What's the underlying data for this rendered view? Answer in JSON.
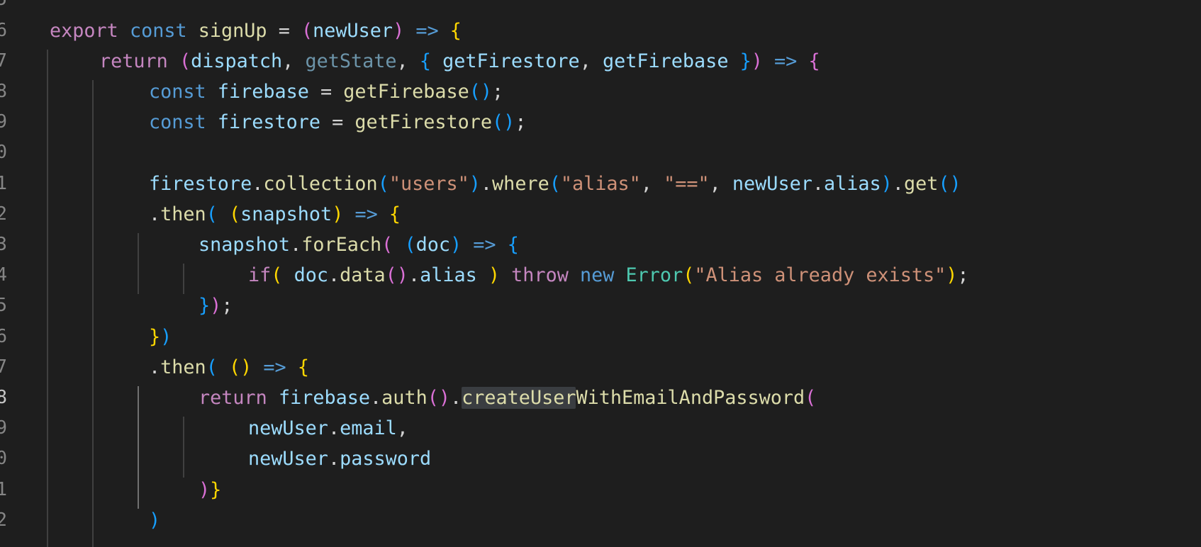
{
  "line_numbers": [
    "5",
    "6",
    "7",
    "8",
    "9",
    "0",
    "1",
    "2",
    "3",
    "4",
    "5",
    "6",
    "7",
    "8",
    "9",
    "0",
    "1",
    "2"
  ],
  "active_line_number": "8",
  "colors": {
    "background": "#1e1e1e",
    "keyword_control": "#c586c0",
    "keyword_storage": "#569cd6",
    "function": "#dcdcaa",
    "variable": "#9cdcfe",
    "string": "#ce9178",
    "class": "#4ec9b0",
    "bracket_1": "#ffd700",
    "bracket_2": "#da70d6",
    "bracket_3": "#179fff",
    "selection_highlight": "#3a3d41"
  },
  "code_lines": [
    [],
    [
      [
        "k-ctrl",
        "export"
      ],
      [
        "punc",
        " "
      ],
      [
        "k-st",
        "const"
      ],
      [
        "punc",
        " "
      ],
      [
        "fn",
        "signUp"
      ],
      [
        "punc",
        " = "
      ],
      [
        "b2",
        "("
      ],
      [
        "var",
        "newUser"
      ],
      [
        "b2",
        ")"
      ],
      [
        "punc",
        " "
      ],
      [
        "k-st",
        "=>"
      ],
      [
        "punc",
        " "
      ],
      [
        "b1",
        "{"
      ]
    ],
    [
      [
        "k-ctrl",
        "return"
      ],
      [
        "punc",
        " "
      ],
      [
        "b2",
        "("
      ],
      [
        "var",
        "dispatch"
      ],
      [
        "punc",
        ", "
      ],
      [
        "dim",
        "getState"
      ],
      [
        "punc",
        ", "
      ],
      [
        "b3",
        "{"
      ],
      [
        "punc",
        " "
      ],
      [
        "var",
        "getFirestore"
      ],
      [
        "punc",
        ", "
      ],
      [
        "var",
        "getFirebase"
      ],
      [
        "punc",
        " "
      ],
      [
        "b3",
        "}"
      ],
      [
        "b2",
        ")"
      ],
      [
        "punc",
        " "
      ],
      [
        "k-st",
        "=>"
      ],
      [
        "punc",
        " "
      ],
      [
        "b2",
        "{"
      ]
    ],
    [
      [
        "k-st",
        "const"
      ],
      [
        "punc",
        " "
      ],
      [
        "var",
        "firebase"
      ],
      [
        "punc",
        " = "
      ],
      [
        "fn",
        "getFirebase"
      ],
      [
        "b3",
        "()"
      ],
      [
        "punc",
        ";"
      ]
    ],
    [
      [
        "k-st",
        "const"
      ],
      [
        "punc",
        " "
      ],
      [
        "var",
        "firestore"
      ],
      [
        "punc",
        " = "
      ],
      [
        "fn",
        "getFirestore"
      ],
      [
        "b3",
        "()"
      ],
      [
        "punc",
        ";"
      ]
    ],
    [],
    [
      [
        "var",
        "firestore"
      ],
      [
        "punc",
        "."
      ],
      [
        "fn",
        "collection"
      ],
      [
        "b3",
        "("
      ],
      [
        "str",
        "\"users\""
      ],
      [
        "b3",
        ")"
      ],
      [
        "punc",
        "."
      ],
      [
        "fn",
        "where"
      ],
      [
        "b3",
        "("
      ],
      [
        "str",
        "\"alias\""
      ],
      [
        "punc",
        ", "
      ],
      [
        "str",
        "\"==\""
      ],
      [
        "punc",
        ", "
      ],
      [
        "var",
        "newUser"
      ],
      [
        "punc",
        "."
      ],
      [
        "var",
        "alias"
      ],
      [
        "b3",
        ")"
      ],
      [
        "punc",
        "."
      ],
      [
        "fn",
        "get"
      ],
      [
        "b3",
        "()"
      ]
    ],
    [
      [
        "punc",
        "."
      ],
      [
        "fn",
        "then"
      ],
      [
        "b3",
        "("
      ],
      [
        "punc",
        " "
      ],
      [
        "b1",
        "("
      ],
      [
        "var",
        "snapshot"
      ],
      [
        "b1",
        ")"
      ],
      [
        "punc",
        " "
      ],
      [
        "k-st",
        "=>"
      ],
      [
        "punc",
        " "
      ],
      [
        "b1",
        "{"
      ]
    ],
    [
      [
        "var",
        "snapshot"
      ],
      [
        "punc",
        "."
      ],
      [
        "fn",
        "forEach"
      ],
      [
        "b2",
        "("
      ],
      [
        "punc",
        " "
      ],
      [
        "b3",
        "("
      ],
      [
        "var",
        "doc"
      ],
      [
        "b3",
        ")"
      ],
      [
        "punc",
        " "
      ],
      [
        "k-st",
        "=>"
      ],
      [
        "punc",
        " "
      ],
      [
        "b3",
        "{"
      ]
    ],
    [
      [
        "k-ctrl",
        "if"
      ],
      [
        "b1",
        "("
      ],
      [
        "punc",
        " "
      ],
      [
        "var",
        "doc"
      ],
      [
        "punc",
        "."
      ],
      [
        "fn",
        "data"
      ],
      [
        "b2",
        "()"
      ],
      [
        "punc",
        "."
      ],
      [
        "var",
        "alias"
      ],
      [
        "punc",
        " "
      ],
      [
        "b1",
        ")"
      ],
      [
        "punc",
        " "
      ],
      [
        "k-ctrl",
        "throw"
      ],
      [
        "punc",
        " "
      ],
      [
        "k-st",
        "new"
      ],
      [
        "punc",
        " "
      ],
      [
        "cls",
        "Error"
      ],
      [
        "b1",
        "("
      ],
      [
        "str",
        "\"Alias already exists\""
      ],
      [
        "b1",
        ")"
      ],
      [
        "punc",
        ";"
      ]
    ],
    [
      [
        "b3",
        "}"
      ],
      [
        "b2",
        ")"
      ],
      [
        "punc",
        ";"
      ]
    ],
    [
      [
        "b1",
        "}"
      ],
      [
        "b3",
        ")"
      ]
    ],
    [
      [
        "punc",
        "."
      ],
      [
        "fn",
        "then"
      ],
      [
        "b3",
        "("
      ],
      [
        "punc",
        " "
      ],
      [
        "b1",
        "()"
      ],
      [
        "punc",
        " "
      ],
      [
        "k-st",
        "=>"
      ],
      [
        "punc",
        " "
      ],
      [
        "b1",
        "{"
      ]
    ],
    [
      [
        "k-ctrl",
        "return"
      ],
      [
        "punc",
        " "
      ],
      [
        "var",
        "firebase"
      ],
      [
        "punc",
        "."
      ],
      [
        "fn",
        "auth"
      ],
      [
        "b2",
        "()"
      ],
      [
        "punc",
        "."
      ],
      [
        "fn hl",
        "createUser"
      ],
      [
        "fn",
        "WithEmailAndPassword"
      ],
      [
        "b2",
        "("
      ]
    ],
    [
      [
        "var",
        "newUser"
      ],
      [
        "punc",
        "."
      ],
      [
        "var",
        "email"
      ],
      [
        "punc",
        ","
      ]
    ],
    [
      [
        "var",
        "newUser"
      ],
      [
        "punc",
        "."
      ],
      [
        "var",
        "password"
      ]
    ],
    [
      [
        "b2",
        ")"
      ],
      [
        "b1",
        "}"
      ]
    ],
    [
      [
        "b3",
        ")"
      ]
    ]
  ]
}
